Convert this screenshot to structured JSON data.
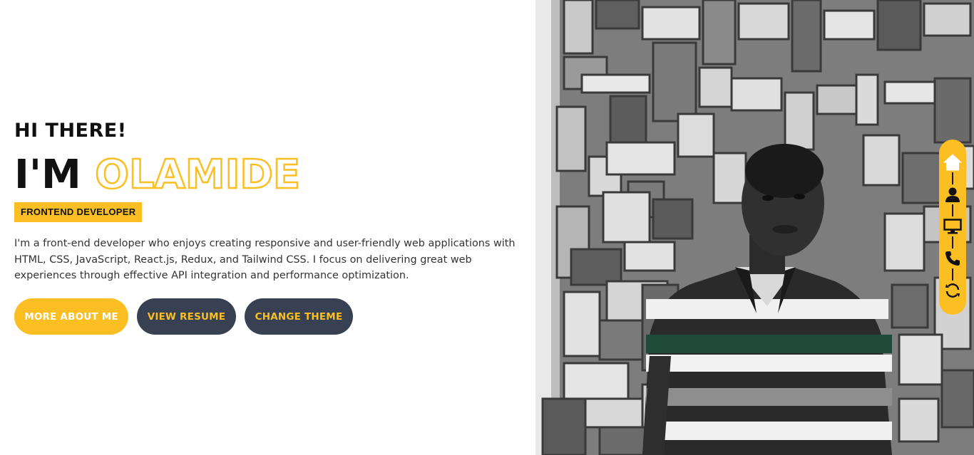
{
  "hero": {
    "greeting": "HI THERE!",
    "name_prefix": "I'M",
    "name": "OLAMIDE",
    "role": "FRONTEND DEVELOPER",
    "bio": "I'm a front-end developer who enjoys creating responsive and user-friendly web applications with HTML, CSS, JavaScript, React.js, Redux, and Tailwind CSS. I focus on delivering great web experiences through effective API integration and performance optimization."
  },
  "buttons": {
    "more_about": "MORE ABOUT ME",
    "view_resume": "VIEW RESUME",
    "change_theme": "CHANGE THEME"
  },
  "side_nav": {
    "items": [
      {
        "icon": "home-icon"
      },
      {
        "icon": "user-icon"
      },
      {
        "icon": "monitor-icon"
      },
      {
        "icon": "phone-icon"
      },
      {
        "icon": "refresh-icon"
      }
    ]
  },
  "colors": {
    "accent": "#fbbf24",
    "dark_button": "#374151",
    "text": "#111111"
  }
}
